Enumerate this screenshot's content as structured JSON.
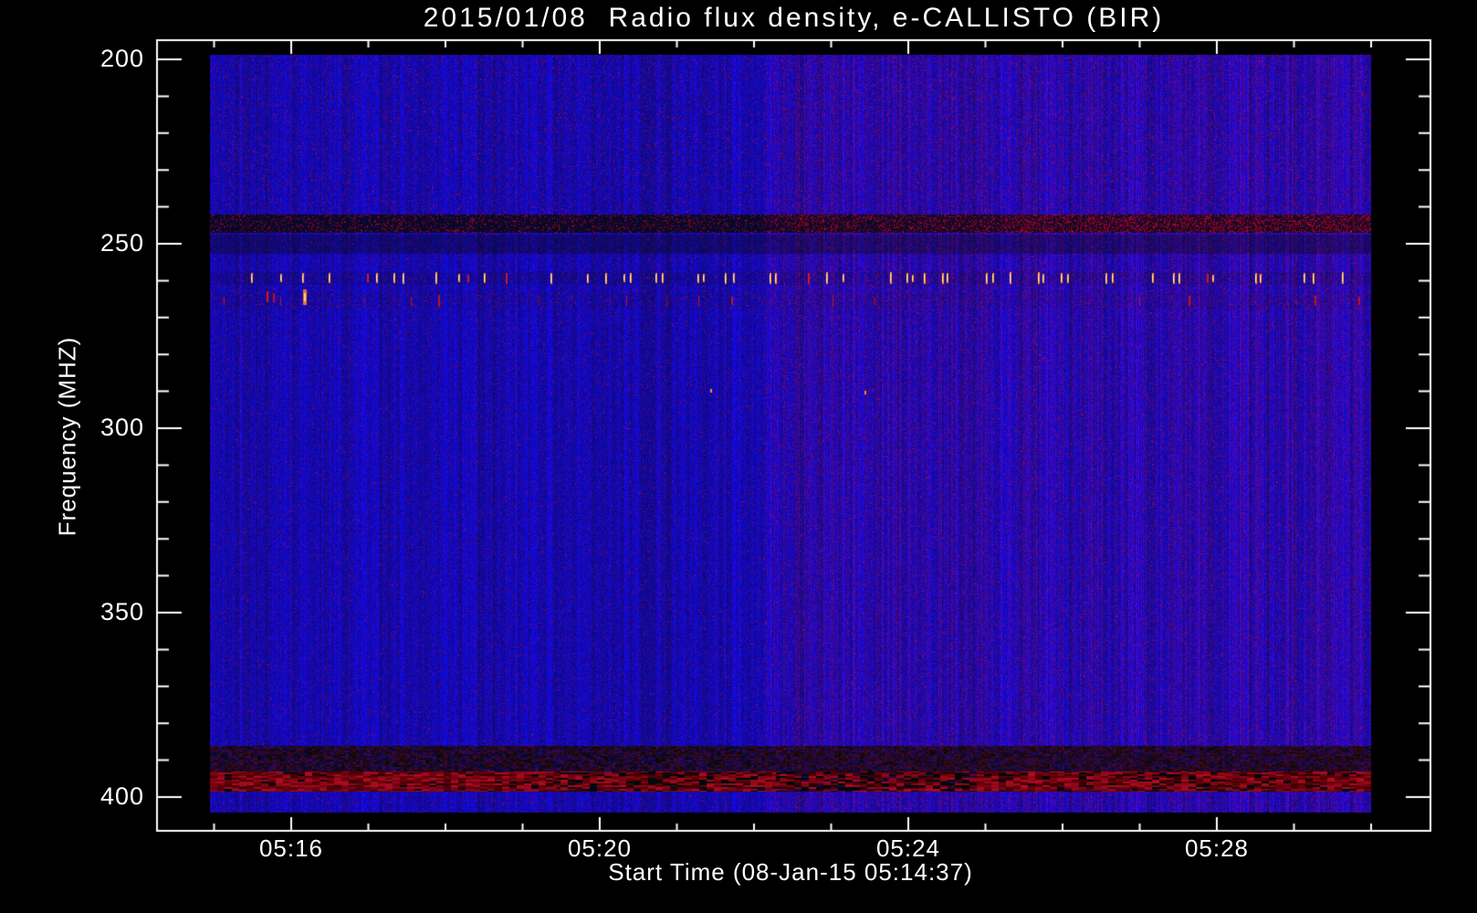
{
  "page": {
    "background": "#000000",
    "text_color": "#FFFFFF"
  },
  "chart_data": {
    "type": "heatmap",
    "subtype": "radio-spectrogram",
    "title": "2015/01/08  Radio flux density, e-CALLISTO (BIR)",
    "xlabel": "Start Time (08-Jan-15 05:14:37)",
    "ylabel": "Frequency (MHZ)",
    "x_tick_labels": [
      "05:16",
      "05:20",
      "05:24",
      "05:28"
    ],
    "x_minor_tick_interval_minutes": 1,
    "x_first_minor_minute": 15,
    "x_last_minor_minute": 30,
    "y_tick_labels": [
      200,
      250,
      300,
      350,
      400
    ],
    "y_minor_tick_interval_mhz": 10,
    "ylim": [
      199,
      404
    ],
    "y_direction": "increasing-downward",
    "grid": false,
    "legend": null,
    "palette": {
      "background": "#000000",
      "axis": "#FFFFFF",
      "base_blue": "#1A10D0",
      "bright_blue": "#2A1FE8",
      "dark_blue": "#0A0680",
      "maroon_speckle": "#6E1048",
      "right_half_tint": "#45129E",
      "dark_band": "#06062E",
      "red_band": "#B01622",
      "dash_core": "#FFF2C0",
      "dash_orange": "#FF9828",
      "dash_red": "#D81818"
    },
    "features": [
      {
        "label": "dark RFI band with red mottle (stronger red at right)",
        "f0": 242,
        "f1": 247,
        "kind": "dark_red_mottle"
      },
      {
        "label": "dim blue band",
        "f0": 247.5,
        "f1": 252.5,
        "kind": "dim"
      },
      {
        "label": "backdrop of periodic bright dash row",
        "f0": 257.5,
        "f1": 261,
        "kind": "dash_zone"
      },
      {
        "label": "sparse red burst row",
        "f0": 263,
        "f1": 267.5,
        "kind": "speckle_zone"
      },
      {
        "label": "dark mottled band near 389 MHz",
        "f0": 386,
        "f1": 393,
        "kind": "dark_mottle"
      },
      {
        "label": "red/black mottled RFI band near 395 MHz",
        "f0": 393,
        "f1": 398.5,
        "kind": "red_mottle"
      }
    ],
    "bright_dash_row_mhz": 259.3,
    "red_dash_row_mhz": 265.5,
    "red_dash_blob": {
      "minute": 16.18,
      "mhz": 264.4
    },
    "bright_specks": [
      {
        "minute": 21.43,
        "mhz": 289.8
      },
      {
        "minute": 23.43,
        "mhz": 290.3
      }
    ],
    "texture_boundary_minute": 22.13
  }
}
